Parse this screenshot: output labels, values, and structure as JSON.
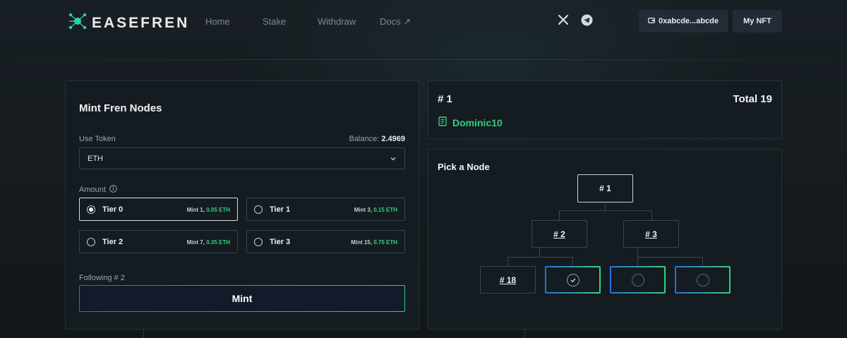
{
  "brand": {
    "name": "EASEFREN"
  },
  "nav": {
    "items": [
      {
        "label": "Home"
      },
      {
        "label": "Stake"
      },
      {
        "label": "Withdraw"
      },
      {
        "label": "Docs ↗"
      }
    ]
  },
  "header": {
    "wallet_label": "0xabcde...abcde",
    "nft_label": "My NFT",
    "social": [
      "x-icon",
      "telegram-icon"
    ]
  },
  "mint": {
    "title": "Mint Fren Nodes",
    "token_label": "Use Token",
    "balance_label": "Balance:",
    "balance_value": "2.4969",
    "token_value": "ETH",
    "amount_label": "Amount",
    "tiers": [
      {
        "name": "Tier 0",
        "mint_prefix": "Mint 1,",
        "price": "0.05 ETH",
        "selected": true
      },
      {
        "name": "Tier 1",
        "mint_prefix": "Mint 3,",
        "price": "0.15 ETH",
        "selected": false
      },
      {
        "name": "Tier 2",
        "mint_prefix": "Mint 7,",
        "price": "0.35 ETH",
        "selected": false
      },
      {
        "name": "Tier 3",
        "mint_prefix": "Mint 15,",
        "price": "0.75 ETH",
        "selected": false
      }
    ],
    "following_label": "Following # 2",
    "button_label": "Mint"
  },
  "info": {
    "number": "# 1",
    "total": "Total 19",
    "name": "Dominic10"
  },
  "tree": {
    "title": "Pick a Node",
    "root": "# 1",
    "level2": [
      "# 2",
      "# 3"
    ],
    "level3": [
      "# 18"
    ]
  },
  "colors": {
    "accent_green": "#35d07f",
    "accent_blue": "#2a6fd6",
    "background": "#141a1f",
    "panel": "#141b21"
  }
}
